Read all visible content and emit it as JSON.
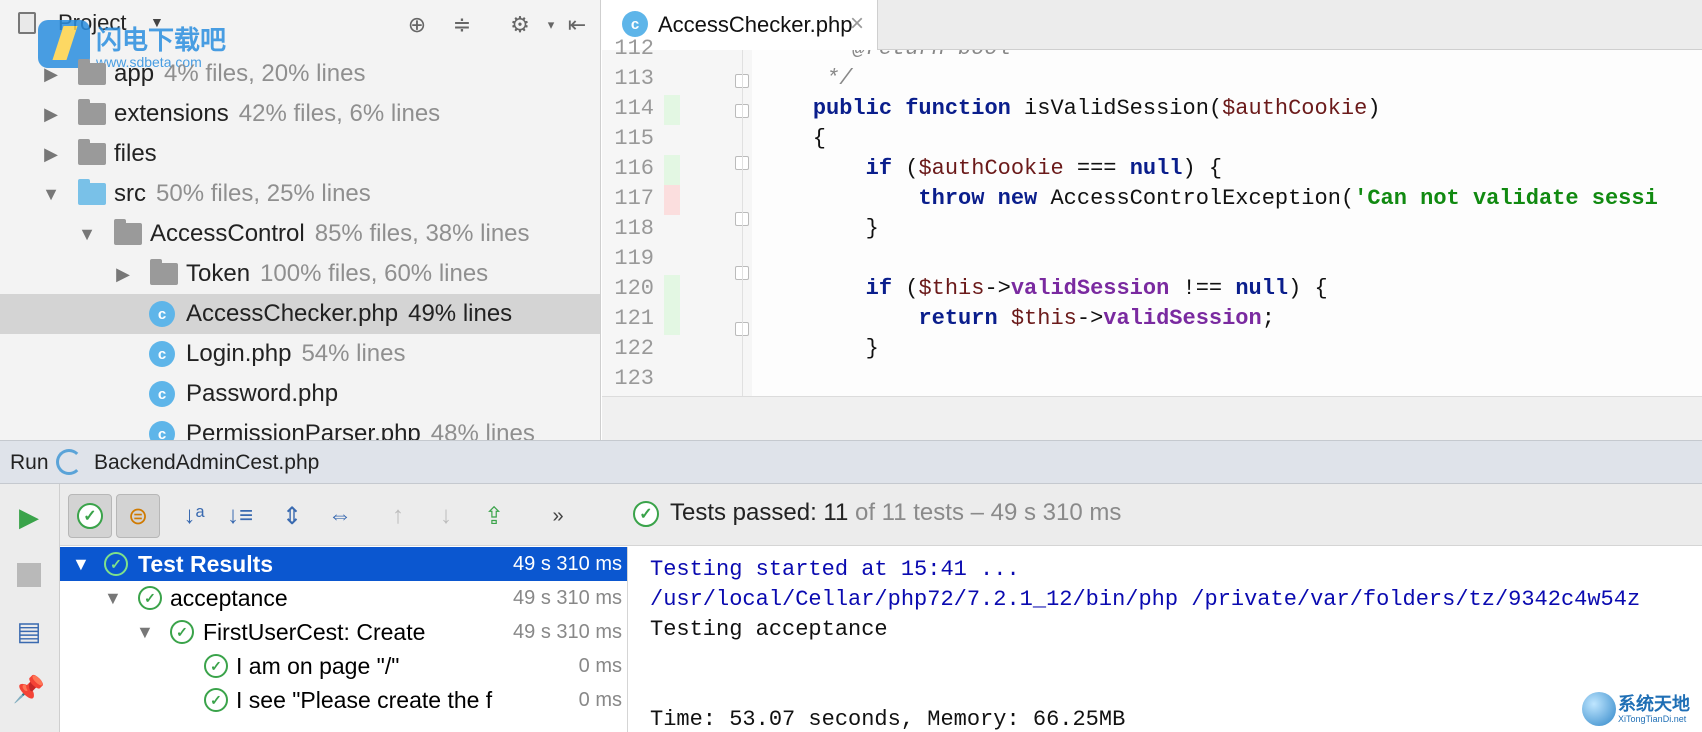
{
  "project_panel": {
    "title": "Project",
    "watermark": {
      "name": "闪电下载吧",
      "url": "www.sdbeta.com"
    },
    "tree": [
      {
        "name": "app",
        "stat": "4% files, 20% lines"
      },
      {
        "name": "extensions",
        "stat": "42% files, 6% lines"
      },
      {
        "name": "files",
        "stat": ""
      },
      {
        "name": "src",
        "stat": "50% files, 25% lines"
      },
      {
        "name": "AccessControl",
        "stat": "85% files, 38% lines"
      },
      {
        "name": "Token",
        "stat": "100% files, 60% lines"
      },
      {
        "name": "AccessChecker.php",
        "stat": "49% lines"
      },
      {
        "name": "Login.php",
        "stat": "54% lines"
      },
      {
        "name": "Password.php",
        "stat": ""
      },
      {
        "name": "PermissionParser.php",
        "stat": "48% lines"
      }
    ]
  },
  "editor": {
    "tab_label": "AccessChecker.php",
    "line_numbers": [
      "112",
      "113",
      "114",
      "115",
      "116",
      "117",
      "118",
      "119",
      "120",
      "121",
      "122",
      "123"
    ]
  },
  "run": {
    "label": "Run",
    "config": "BackendAdminCest.php",
    "status": {
      "passed": "Tests passed: 11",
      "detail": "of 11 tests – 49 s 310 ms"
    }
  },
  "test_tree": [
    {
      "name": "Test Results",
      "duration": "49 s 310 ms"
    },
    {
      "name": "acceptance",
      "duration": "49 s 310 ms"
    },
    {
      "name": "FirstUserCest: Create",
      "duration": "49 s 310 ms"
    },
    {
      "name": "I am on page \"/\"",
      "duration": "0 ms"
    },
    {
      "name": "I see \"Please create the f",
      "duration": "0 ms"
    }
  ],
  "console": {
    "lines": [
      "Testing started at 15:41 ...",
      "/usr/local/Cellar/php72/7.2.1_12/bin/php /private/var/folders/tz/9342c4w54z",
      "Testing acceptance",
      "Time: 53.07 seconds, Memory: 66.25MB"
    ]
  },
  "corner_logo": {
    "name": "系统天地",
    "url": "XiTongTianDi.net"
  },
  "colors": {
    "selection": "#0b57d0",
    "pass_green": "#3aa34a",
    "added_line": "#e3f7e3",
    "modified_line": "#fbdede"
  }
}
